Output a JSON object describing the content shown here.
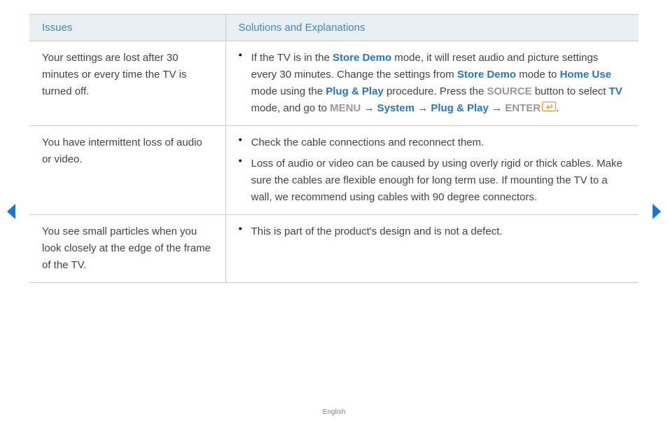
{
  "header": {
    "issues": "Issues",
    "solutions": "Solutions and Explanations"
  },
  "rows": [
    {
      "issue": "Your settings are lost after 30 minutes or every time the TV is turned off.",
      "solutions": [
        [
          {
            "t": "If the TV is in the ",
            "cls": ""
          },
          {
            "t": "Store Demo",
            "cls": "hl"
          },
          {
            "t": " mode, it will reset audio and picture settings every 30 minutes. Change the settings from ",
            "cls": ""
          },
          {
            "t": "Store Demo",
            "cls": "hl"
          },
          {
            "t": " mode to ",
            "cls": ""
          },
          {
            "t": "Home Use",
            "cls": "hl"
          },
          {
            "t": " mode using the ",
            "cls": ""
          },
          {
            "t": "Plug & Play",
            "cls": "hl"
          },
          {
            "t": " procedure. Press the ",
            "cls": ""
          },
          {
            "t": "SOURCE",
            "cls": "grey"
          },
          {
            "t": " button to select ",
            "cls": ""
          },
          {
            "t": "TV",
            "cls": "hl"
          },
          {
            "t": " mode, and go to ",
            "cls": ""
          },
          {
            "t": "MENU",
            "cls": "grey"
          },
          {
            "t": " → ",
            "cls": ""
          },
          {
            "t": "System",
            "cls": "hl"
          },
          {
            "t": " → ",
            "cls": ""
          },
          {
            "t": "Plug & Play",
            "cls": "hl"
          },
          {
            "t": " → ",
            "cls": ""
          },
          {
            "t": "ENTER",
            "cls": "grey"
          },
          {
            "t": "",
            "cls": "icon-enter"
          },
          {
            "t": ".",
            "cls": ""
          }
        ]
      ]
    },
    {
      "issue": "You have intermittent loss of audio or video.",
      "solutions": [
        [
          {
            "t": "Check the cable connections and reconnect them.",
            "cls": ""
          }
        ],
        [
          {
            "t": "Loss of audio or video can be caused by using overly rigid or thick cables. Make sure the cables are flexible enough for long term use. If mounting the TV to a wall, we recommend using cables with 90 degree connectors.",
            "cls": ""
          }
        ]
      ]
    },
    {
      "issue": "You see small particles when you look closely at the edge of the frame of the TV.",
      "solutions": [
        [
          {
            "t": "This is part of the product's design and is not a defect.",
            "cls": ""
          }
        ]
      ]
    }
  ],
  "footer": "English"
}
